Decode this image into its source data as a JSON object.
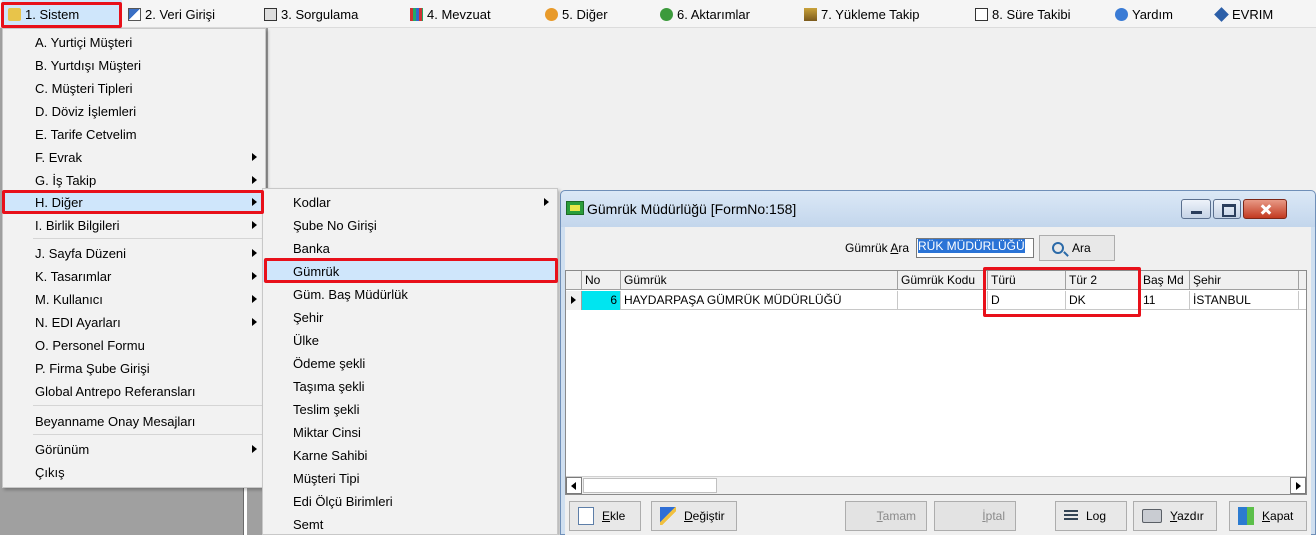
{
  "menubar": {
    "items": [
      {
        "label": "1.  Sistem"
      },
      {
        "label": "2.  Veri Girişi"
      },
      {
        "label": "3.  Sorgulama"
      },
      {
        "label": "4.  Mevzuat"
      },
      {
        "label": "5.  Diğer"
      },
      {
        "label": "6.  Aktarımlar"
      },
      {
        "label": "7.  Yükleme Takip"
      },
      {
        "label": "8. Süre Takibi"
      },
      {
        "label": "Yardım"
      },
      {
        "label": "EVRIM"
      }
    ]
  },
  "sistem_menu": {
    "items": [
      {
        "label": "A.  Yurtiçi Müşteri"
      },
      {
        "label": "B.  Yurtdışı Müşteri"
      },
      {
        "label": "C.  Müşteri Tipleri"
      },
      {
        "label": "D.  Döviz İşlemleri"
      },
      {
        "label": "E.  Tarife Cetvelim"
      },
      {
        "label": "F.  Evrak"
      },
      {
        "label": "G.  İş Takip"
      },
      {
        "label": "H.  Diğer"
      },
      {
        "label": "I.  Birlik Bilgileri"
      },
      {
        "label": "J.  Sayfa Düzeni"
      },
      {
        "label": "K.  Tasarımlar"
      },
      {
        "label": "M.   Kullanıcı"
      },
      {
        "label": "N.  EDI Ayarları"
      },
      {
        "label": "O.  Personel Formu"
      },
      {
        "label": "P.   Firma Şube Girişi"
      },
      {
        "label": "Global Antrepo Referansları"
      },
      {
        "label": "Beyanname Onay Mesajları"
      },
      {
        "label": "Görünüm"
      },
      {
        "label": "Çıkış"
      }
    ]
  },
  "diger_menu": {
    "items": [
      {
        "label": "Kodlar"
      },
      {
        "label": "Şube No Girişi"
      },
      {
        "label": "Banka"
      },
      {
        "label": "Gümrük"
      },
      {
        "label": "Güm. Baş Müdürlük"
      },
      {
        "label": "Şehir"
      },
      {
        "label": "Ülke"
      },
      {
        "label": "Ödeme şekli"
      },
      {
        "label": "Taşıma şekli"
      },
      {
        "label": "Teslim şekli"
      },
      {
        "label": "Miktar Cinsi"
      },
      {
        "label": "Karne Sahibi"
      },
      {
        "label": "Müşteri  Tipi"
      },
      {
        "label": "Edi Ölçü Birimleri"
      },
      {
        "label": "Semt"
      }
    ]
  },
  "window": {
    "title": "Gümrük Müdürlüğü [FormNo:158]",
    "search_label_pre": "Gümrük ",
    "search_label_u": "A",
    "search_label_post": "ra",
    "search_value": "RÜK MÜDÜRLÜĞÜ",
    "search_button": "Ara",
    "columns": [
      "No",
      "Gümrük",
      "Gümrük Kodu",
      "Türü",
      "Tür 2",
      "Baş Md",
      "Şehir"
    ],
    "rows": [
      {
        "no": "6",
        "gumruk": "HAYDARPAŞA GÜMRÜK MÜDÜRLÜĞÜ",
        "kod": "",
        "turu": "D",
        "tur2": "DK",
        "bas_md": "11",
        "sehir": "İSTANBUL"
      }
    ],
    "buttons": {
      "ekle": {
        "u": "E",
        "rest": "kle"
      },
      "degistir": {
        "u": "D",
        "rest": "eğiştir"
      },
      "tamam": {
        "u": "T",
        "rest": "amam"
      },
      "iptal": {
        "u": "İ",
        "rest": "ptal"
      },
      "log": "Log",
      "yazdir": {
        "u": "Y",
        "rest": "azdır"
      },
      "kapat": {
        "u": "K",
        "rest": "apat"
      }
    }
  },
  "colors": {
    "accent_red": "#e8101a",
    "highlight": "#cfe6fb",
    "selection_cell": "#00e5f0"
  }
}
